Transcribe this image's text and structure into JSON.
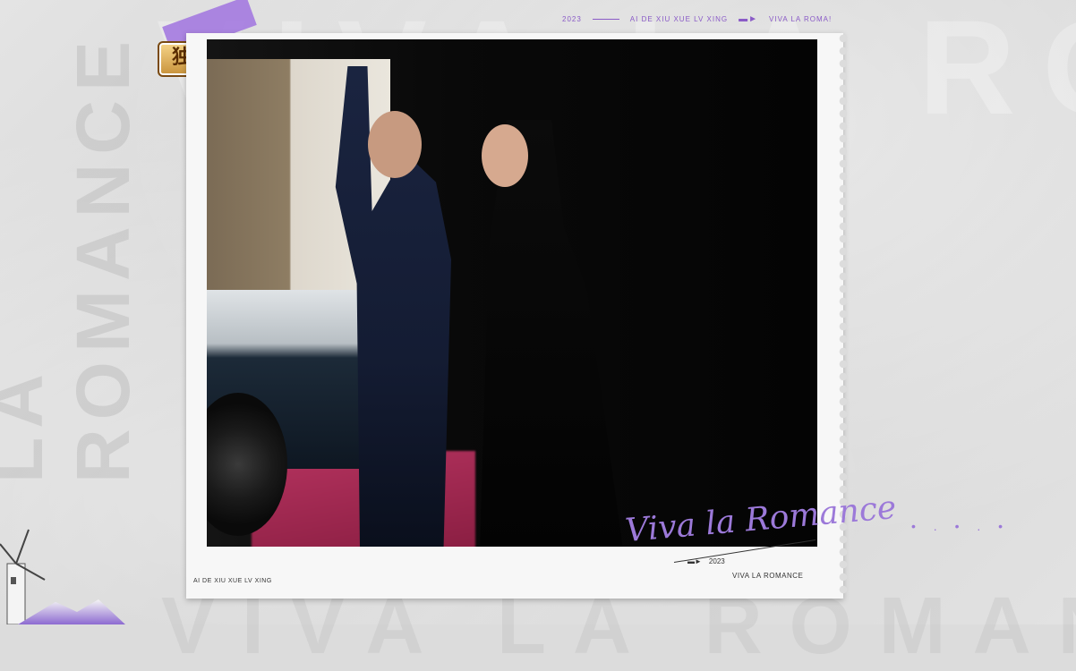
{
  "background": {
    "big_letters_top": "VIVA LA RO",
    "big_letters_bottom": "VIVA LA ROMANCE",
    "vertical_letters": "LA ROMANCE"
  },
  "top_strip": {
    "year": "2023",
    "subtitle": "AI DE XIU XUE LV XING",
    "right": "VIVA LA ROMA!"
  },
  "badge": {
    "label": "独播"
  },
  "postcard": {
    "left_label": "AI DE XIU XUE LV XING",
    "year": "2023",
    "right_label": "VIVA LA ROMANCE"
  },
  "overlay": {
    "script_title": "Viva la Romance",
    "dots": "• . • . •"
  },
  "colors": {
    "accent_purple": "#9c79d9",
    "badge_gold": "#d9a64f"
  }
}
